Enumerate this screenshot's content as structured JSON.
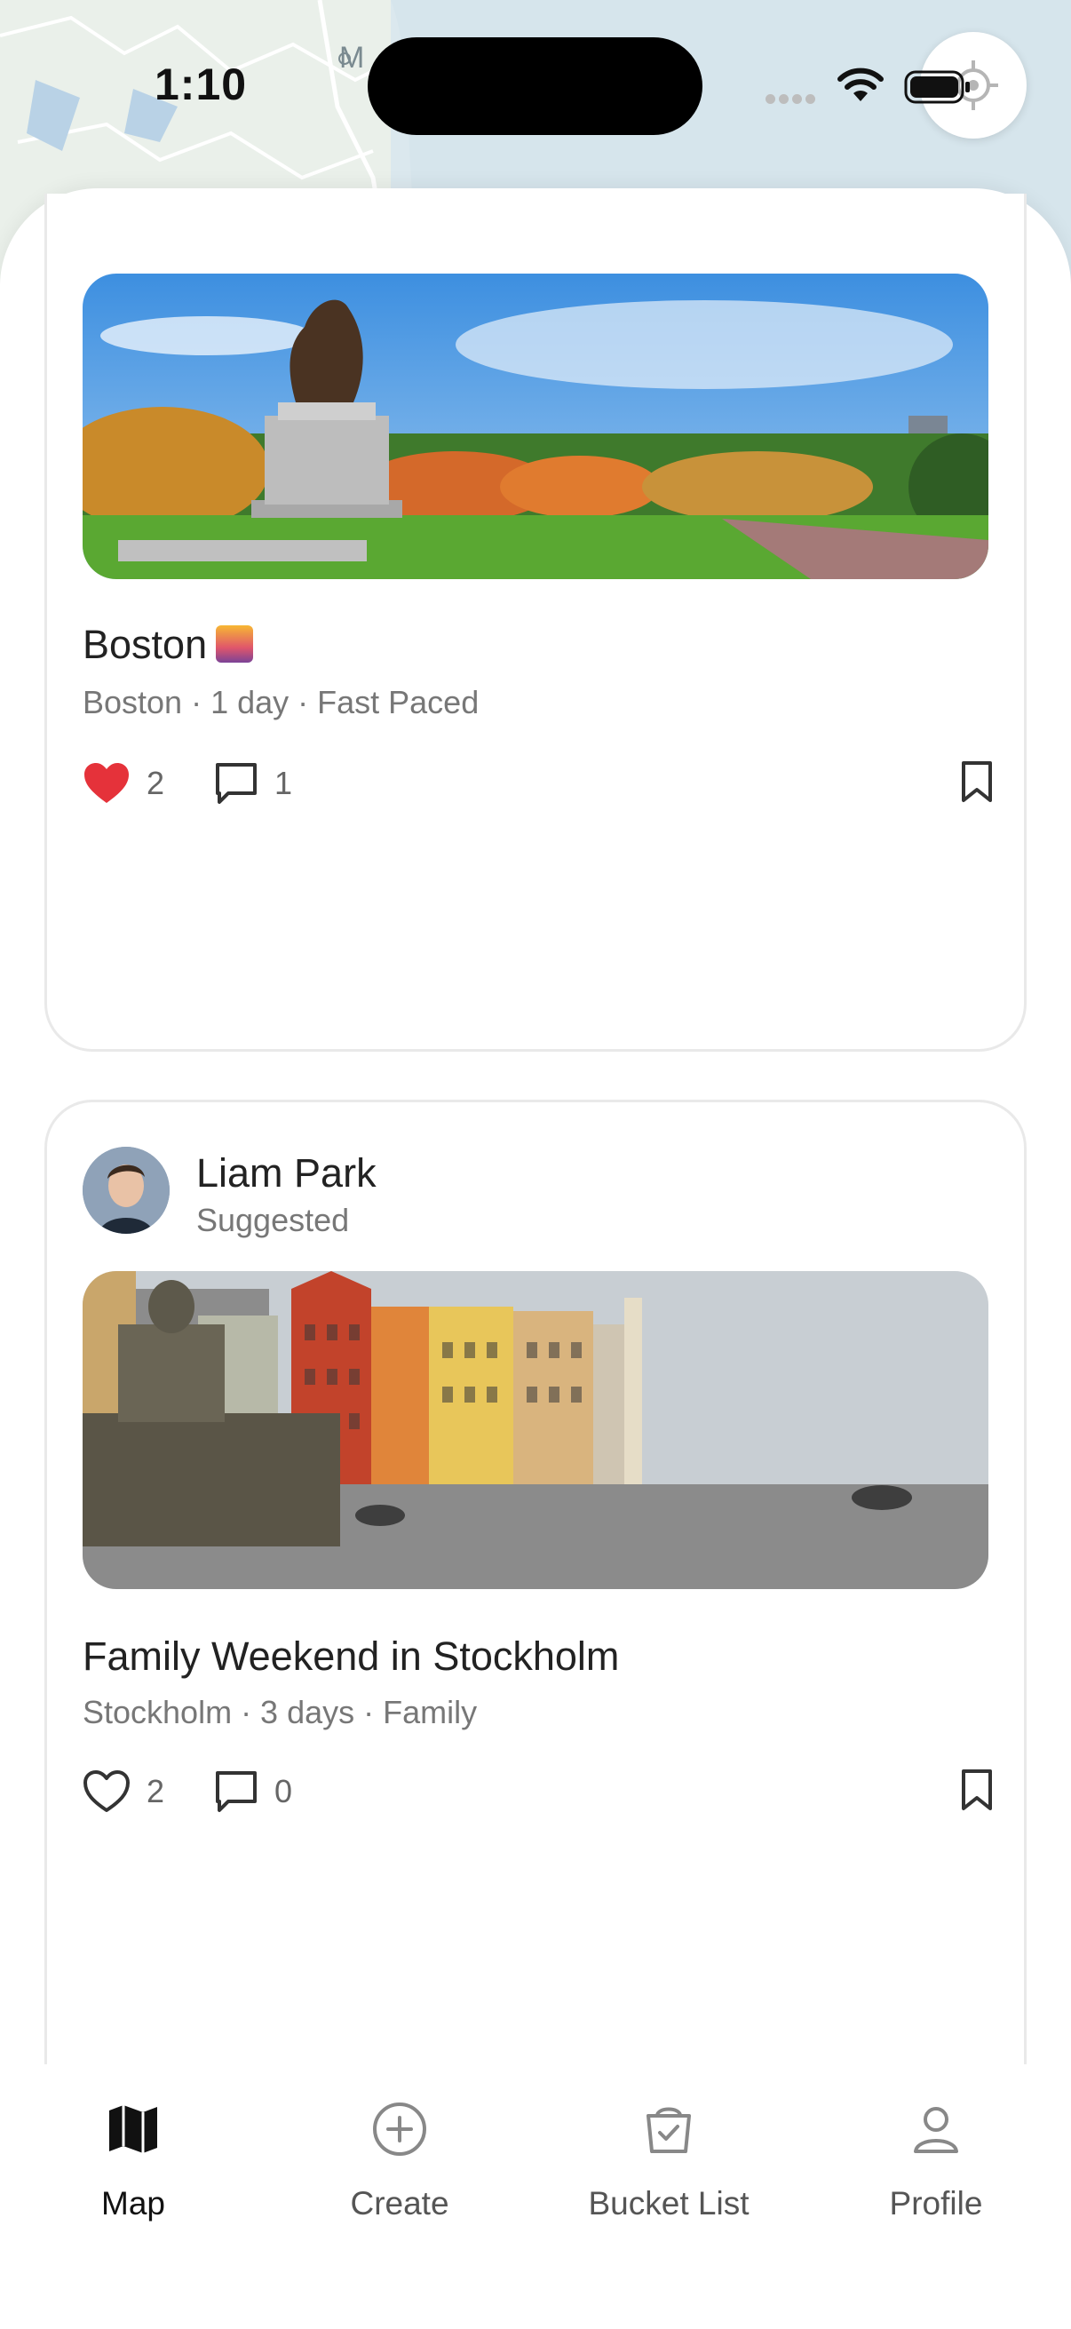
{
  "status_bar": {
    "time": "1:10"
  },
  "map": {
    "partial_label": "M"
  },
  "posts": [
    {
      "title": "Boston",
      "meta": "Boston · 1 day · Fast Paced",
      "likes": "2",
      "liked": true,
      "comments": "1"
    },
    {
      "author": "Liam Park",
      "author_tag": "Suggested",
      "title": "Family Weekend in Stockholm",
      "meta": "Stockholm · 3 days · Family",
      "likes": "2",
      "liked": false,
      "comments": "0"
    }
  ],
  "tabs": [
    {
      "label": "Map",
      "icon": "map-icon",
      "active": true
    },
    {
      "label": "Create",
      "icon": "plus-circle-icon",
      "active": false
    },
    {
      "label": "Bucket List",
      "icon": "bucket-check-icon",
      "active": false
    },
    {
      "label": "Profile",
      "icon": "person-icon",
      "active": false
    }
  ],
  "colors": {
    "like_red": "#e5323a",
    "text_primary": "#222222",
    "text_secondary": "#777777"
  }
}
